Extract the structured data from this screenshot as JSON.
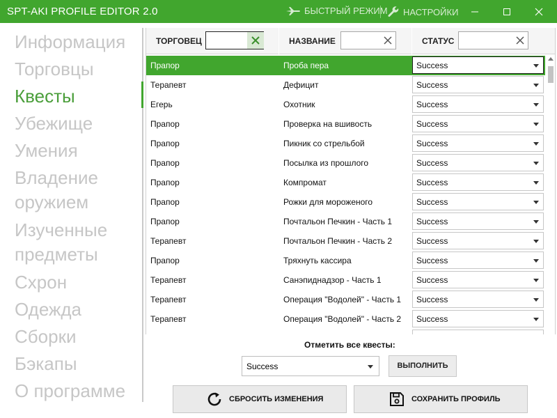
{
  "titlebar": {
    "title": "SPT-AKI PROFILE EDITOR  2.0",
    "fast_mode": "БЫСТРЫЙ РЕЖИМ",
    "settings": "НАСТРОЙКИ"
  },
  "sidebar": {
    "items": [
      {
        "label": "Информация",
        "active": false
      },
      {
        "label": "Торговцы",
        "active": false
      },
      {
        "label": "Квесты",
        "active": true
      },
      {
        "label": "Убежище",
        "active": false
      },
      {
        "label": "Умения",
        "active": false
      },
      {
        "label": "Владение оружием",
        "active": false
      },
      {
        "label": "Изученные предметы",
        "active": false
      },
      {
        "label": "Схрон",
        "active": false
      },
      {
        "label": "Одежда",
        "active": false
      },
      {
        "label": "Сборки",
        "active": false
      },
      {
        "label": "Бэкапы",
        "active": false
      },
      {
        "label": "О программе",
        "active": false
      }
    ]
  },
  "grid": {
    "columns": {
      "trader": "ТОРГОВЕЦ",
      "name": "НАЗВАНИЕ",
      "status": "СТАТУС"
    },
    "filters": {
      "trader": "",
      "name": "",
      "status": ""
    },
    "rows": [
      {
        "trader": "Прапор",
        "name": "Проба пера",
        "status": "Success",
        "selected": true
      },
      {
        "trader": "Терапевт",
        "name": "Дефицит",
        "status": "Success"
      },
      {
        "trader": "Егерь",
        "name": "Охотник",
        "status": "Success"
      },
      {
        "trader": "Прапор",
        "name": "Проверка на вшивость",
        "status": "Success"
      },
      {
        "trader": "Прапор",
        "name": "Пикник со стрельбой",
        "status": "Success"
      },
      {
        "trader": "Прапор",
        "name": "Посылка из прошлого",
        "status": "Success"
      },
      {
        "trader": "Прапор",
        "name": "Компромат",
        "status": "Success"
      },
      {
        "trader": "Прапор",
        "name": "Рожки для мороженого",
        "status": "Success"
      },
      {
        "trader": "Прапор",
        "name": "Почтальон Печкин - Часть 1",
        "status": "Success"
      },
      {
        "trader": "Терапевт",
        "name": "Почтальон Печкин - Часть 2",
        "status": "Success"
      },
      {
        "trader": "Прапор",
        "name": "Тряхнуть кассира",
        "status": "Success"
      },
      {
        "trader": "Терапевт",
        "name": "Санэпиднадзор - Часть 1",
        "status": "Success"
      },
      {
        "trader": "Терапевт",
        "name": "Операция \"Водолей\" - Часть 1",
        "status": "Success"
      },
      {
        "trader": "Терапевт",
        "name": "Операция \"Водолей\" - Часть 2",
        "status": "Success"
      }
    ]
  },
  "bulk": {
    "label": "Отметить все квесты:",
    "selected": "Success",
    "run_label": "ВЫПОЛНИТЬ"
  },
  "actions": {
    "reset_label": "СБРОСИТЬ ИЗМЕНЕНИЯ",
    "save_label": "СОХРАНИТЬ ПРОФИЛЬ"
  },
  "colors": {
    "accent": "#41a62e",
    "sidebar_inactive": "#c6c6c6",
    "sidebar_active": "#4a9e3a"
  }
}
